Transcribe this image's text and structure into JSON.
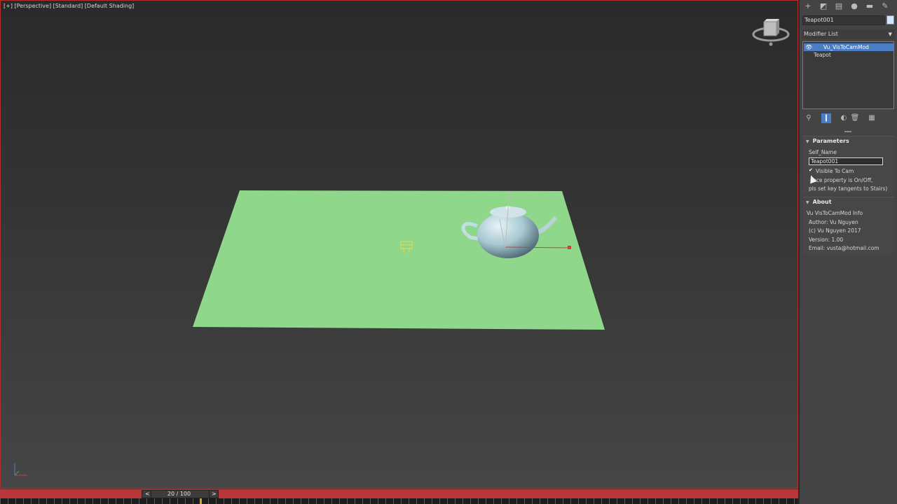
{
  "viewport": {
    "label": "[+] [Perspective] [Standard] [Default Shading]"
  },
  "timeline": {
    "prev": "<",
    "frame": "20 / 100",
    "next": ">",
    "progress": 0.2
  },
  "command_panel": {
    "tabs": [
      "create-icon",
      "modify-icon",
      "hierarchy-icon",
      "motion-icon",
      "display-icon",
      "utilities-icon"
    ],
    "object_name": "Teapot001",
    "object_color": "#cfe8ff",
    "modifier_list_label": "Modifier List",
    "stack": [
      "Vu_VisToCamMod",
      "Teapot"
    ],
    "parameters": {
      "title": "Parameters",
      "self_name_label": "Self_Name",
      "self_name_value": "Teapot001",
      "visible_to_cam_label": "Visible To Cam",
      "note_line1": "nce property is On/Off,",
      "note_line2": "pls set key tangents to Stairs)"
    },
    "about": {
      "title": "About",
      "heading": "Vu VisToCamMod Info",
      "author": "Author: Vu Nguyen",
      "copyright": "(c) Vu Nguyen 2017",
      "version": "Version: 1.00",
      "email": "Email: vusta@hotmail.com"
    }
  },
  "colors": {
    "plane": "#8fd78a",
    "selected_stack_row": "#4a7dc4",
    "timeline": "#b8383a"
  }
}
